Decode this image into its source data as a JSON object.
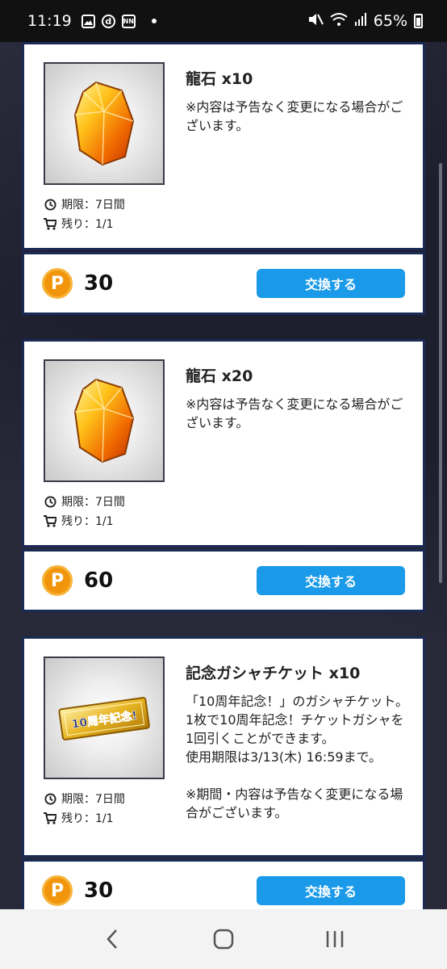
{
  "status_bar": {
    "time": "11:19",
    "battery": "65%",
    "icons": [
      "gallery-icon",
      "d-icon",
      "nn-icon",
      "mute-icon",
      "wifi-icon",
      "signal-icon",
      "battery-icon"
    ]
  },
  "items": [
    {
      "title": "龍石 x10",
      "description": "※内容は予告なく変更になる場合がございます。",
      "icon": "dragon-stone-icon",
      "period_label": "期限：7日間",
      "remaining_label": "残り：1/1",
      "coin_symbol": "P",
      "price": "30",
      "button_label": "交換する"
    },
    {
      "title": "龍石 x20",
      "description": "※内容は予告なく変更になる場合がございます。",
      "icon": "dragon-stone-icon",
      "period_label": "期限：7日間",
      "remaining_label": "残り：1/1",
      "coin_symbol": "P",
      "price": "60",
      "button_label": "交換する"
    },
    {
      "title": "記念ガシャチケット x10",
      "description": "「10周年記念！」のガシャチケット。\n1枚で10周年記念！チケットガシャを1回引くことができます。\n使用期限は3/13(木) 16:59まで。\n\n※期間・内容は予告なく変更になる場合がございます。",
      "icon": "gacha-ticket-icon",
      "ticket_text": "10周年記念!",
      "period_label": "期限：7日間",
      "remaining_label": "残り：1/1",
      "coin_symbol": "P",
      "price": "30",
      "button_label": "交換する"
    }
  ],
  "colors": {
    "button": "#1a9ae8",
    "coin": "#f1960c",
    "card_border": "#1a2a55"
  },
  "nav": [
    "back-icon",
    "home-icon",
    "recents-icon"
  ]
}
